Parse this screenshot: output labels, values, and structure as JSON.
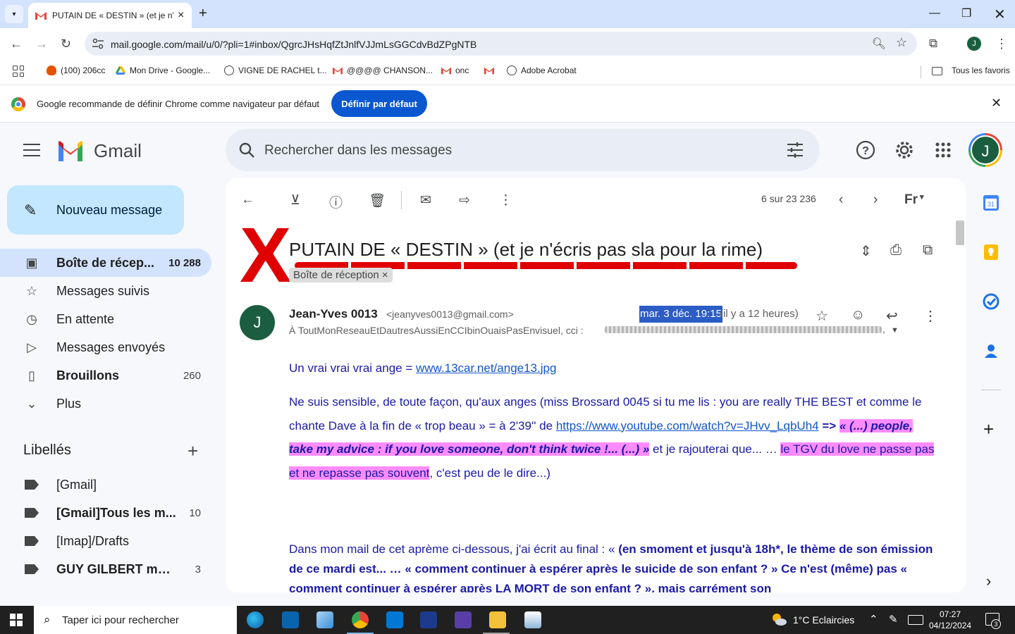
{
  "browser": {
    "tab_title": "PUTAIN DE « DESTIN » (et je n'é",
    "url": "mail.google.com/mail/u/0/?pli=1#inbox/QgrcJHsHqfZtJnlfVJJmLsGGCdvBdZPgNTB",
    "profile_initial": "J",
    "bookmarks": [
      {
        "label": "(100) 206cc",
        "icon": "fire-icon",
        "color": "#e65100"
      },
      {
        "label": "Mon Drive - Google...",
        "icon": "drive-icon",
        "color": "#fbbc04"
      },
      {
        "label": "VIGNE DE RACHEL t...",
        "icon": "globe-icon",
        "color": "#444746"
      },
      {
        "label": "@@@@ CHANSON...",
        "icon": "gmail-icon",
        "color": "#ea4335"
      },
      {
        "label": "onc",
        "icon": "gmail-icon",
        "color": "#ea4335"
      },
      {
        "label": "",
        "icon": "gmail-icon",
        "color": "#ea4335"
      },
      {
        "label": "Adobe Acrobat",
        "icon": "globe-icon",
        "color": "#444746"
      }
    ],
    "all_bookmarks_label": "Tous les favoris"
  },
  "infobar": {
    "message": "Google recommande de définir Chrome comme navigateur par défaut",
    "button_label": "Définir par défaut"
  },
  "gmail": {
    "brand": "Gmail",
    "search_placeholder": "Rechercher dans les messages",
    "avatar_initial": "J",
    "compose_label": "Nouveau message",
    "nav": [
      {
        "label": "Boîte de récep...",
        "count": "10 288",
        "icon": "inbox-icon",
        "active": true,
        "bold": true
      },
      {
        "label": "Messages suivis",
        "count": "",
        "icon": "star-icon",
        "active": false,
        "bold": false
      },
      {
        "label": "En attente",
        "count": "",
        "icon": "clock-icon",
        "active": false,
        "bold": false
      },
      {
        "label": "Messages envoyés",
        "count": "",
        "icon": "send-icon",
        "active": false,
        "bold": false
      },
      {
        "label": "Brouillons",
        "count": "260",
        "icon": "draft-icon",
        "active": false,
        "bold": true
      },
      {
        "label": "Plus",
        "count": "",
        "icon": "chevron-down-icon",
        "active": false,
        "bold": false
      }
    ],
    "labels_title": "Libellés",
    "labels": [
      {
        "label": "[Gmail]",
        "count": "",
        "bold": false
      },
      {
        "label": "[Gmail]Tous les m...",
        "count": "10",
        "bold": true
      },
      {
        "label": "[Imap]/Drafts",
        "count": "",
        "bold": false
      },
      {
        "label": "GUY GILBERT mail...",
        "count": "3",
        "bold": true
      }
    ],
    "pager": "6 sur 23 236",
    "input_tool": "Fr",
    "subject": "PUTAIN DE « DESTIN » (et je n'écris pas sla pour la rime)",
    "annotation_mark": "X",
    "inbox_chip": "Boîte de réception",
    "chip_close": "×",
    "sender_initial": "J",
    "sender_name": "Jean-Yves 0013",
    "sender_email": "<jeanyves0013@gmail.com>",
    "date": "mar. 3 déc. 19:15",
    "ago": "(il y a 12 heures)",
    "recipients": "À ToutMonReseauEtDautresAussiEnCCIbinOuaisPasEnvisuel, cci :",
    "recipients_tail": ",",
    "body": {
      "p1_text": "Un vrai vrai vrai ange = ",
      "p1_link": "www.13car.net/ange13.jpg",
      "p2_a": "Ne suis sensible, de toute façon, qu'aux anges (miss Brossard 0045 si tu me lis : you are really THE BEST et comme le chante Dave à la fin de « trop beau » = à 2'39'' de ",
      "p2_link": "https://www.youtube.com/watch?v=JHvv_LqbUh4",
      "p2_b": "=> ",
      "p2_quote": "« (...) people, take my advice : if you love someone, don't think twice !... (...) »",
      "p2_c": " et je rajouterai que... … ",
      "p2_hl": "le TGV du love ne passe pas et ne repasse pas souvent",
      "p2_d": ", c'est peu de le dire...)",
      "p3_a": "Dans mon mail de cet aprème ci-dessous, j'ai écrit au final : « ",
      "p3_bold": "(en smoment et jusqu'à 18h*, le thème de son émission de ce mardi est... … « comment continuer à espérer après le suicide de son enfant ? » Ce n'est (même) pas « comment continuer à espérer après LA MORT de son enfant ? », mais carrément son"
    }
  },
  "taskbar": {
    "search_placeholder": "Taper ici pour rechercher",
    "weather": "1°C  Eclaircies",
    "time": "07:27",
    "date": "04/12/2024",
    "notifications": "3"
  }
}
